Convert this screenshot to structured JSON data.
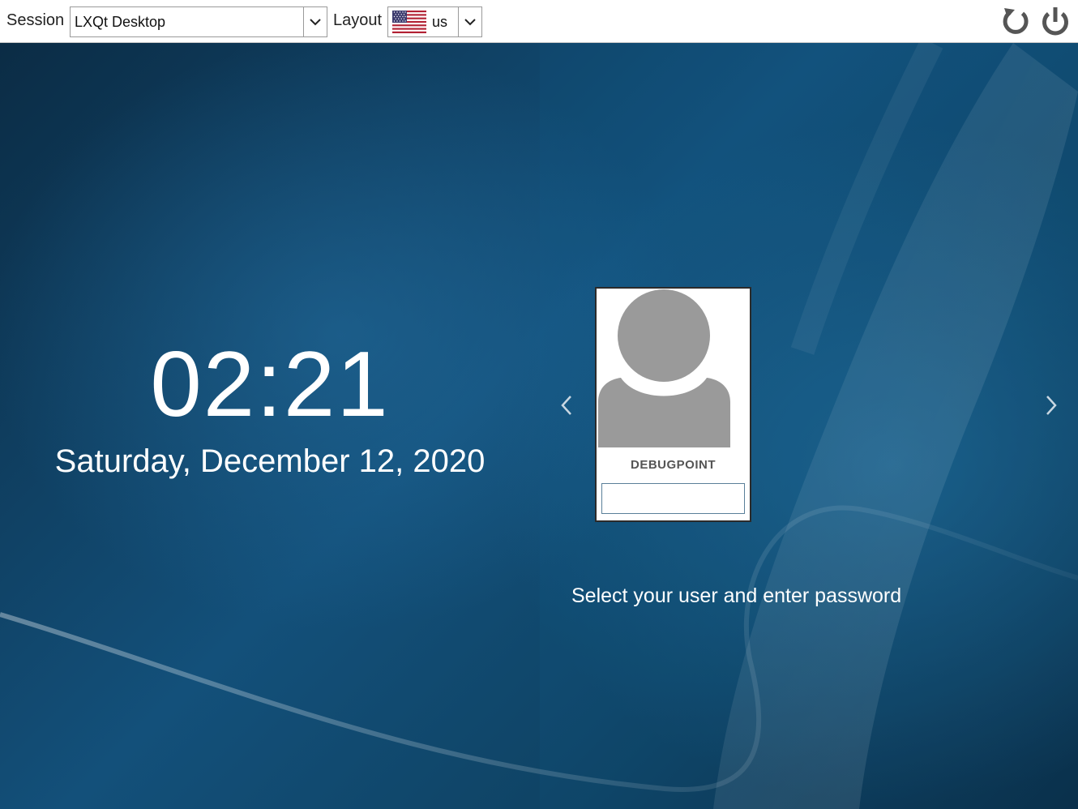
{
  "topbar": {
    "session_label": "Session",
    "session_value": "LXQt Desktop",
    "layout_label": "Layout",
    "layout_value": "us",
    "layout_flag": "us-flag-icon"
  },
  "clock": {
    "time": "02:21",
    "date": "Saturday, December 12, 2020"
  },
  "user": {
    "name": "DEBUGPOINT",
    "password_value": ""
  },
  "hint": "Select your user and enter password",
  "icons": {
    "restart": "restart-icon",
    "shutdown": "power-icon",
    "prev": "chevron-left-icon",
    "next": "chevron-right-icon",
    "avatar": "user-avatar-icon"
  },
  "colors": {
    "background_dark": "#0b2c45",
    "background_mid": "#13507a",
    "card_bg": "#ffffff",
    "avatar_gray": "#9a9a9a"
  }
}
